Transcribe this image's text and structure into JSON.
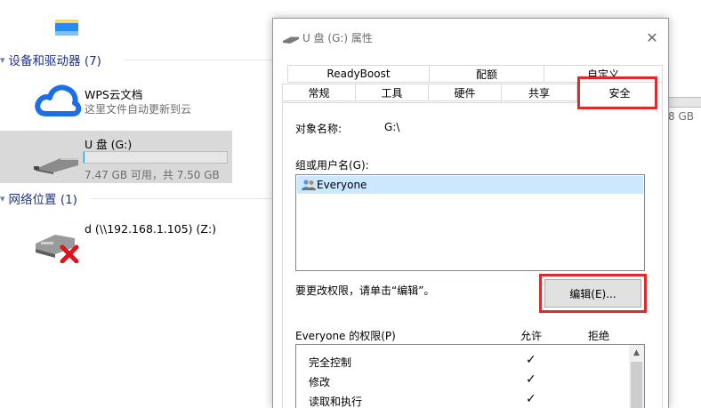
{
  "explorer": {
    "groups": [
      {
        "label": "设备和驱动器 (7)"
      },
      {
        "label": "网络位置 (1)"
      }
    ],
    "items": [
      {
        "title": "WPS云文档",
        "subtitle": "这里文件自动更新到云",
        "icon": "cloud-icon"
      },
      {
        "title": "U 盘 (G:)",
        "subtitle": "7.47 GB 可用，共 7.50 GB",
        "usage_fraction": 0.004,
        "icon": "usb-drive-icon"
      },
      {
        "title": "d (\\\\192.168.1.105) (Z:)",
        "icon": "disconnected-network-drive-icon"
      }
    ],
    "right_fragment": "8 GB"
  },
  "dialog": {
    "title": "U 盘 (G:) 属性",
    "close_glyph": "✕",
    "tabs_row1": [
      "ReadyBoost",
      "配额",
      "自定义"
    ],
    "tabs_row2": [
      "常规",
      "工具",
      "硬件",
      "共享",
      "安全"
    ],
    "active_tab": "安全",
    "object_name_label": "对象名称:",
    "object_name_value": "G:\\",
    "group_label": "组或用户名(G):",
    "users": [
      "Everyone"
    ],
    "change_hint": "要更改权限，请单击“编辑”。",
    "edit_button": "编辑(E)...",
    "perm_header": "Everyone 的权限(P)",
    "allow_label": "允许",
    "deny_label": "拒绝",
    "permissions": [
      {
        "name": "完全控制",
        "allow": "✓"
      },
      {
        "name": "修改",
        "allow": "✓"
      },
      {
        "name": "读取和执行",
        "allow": "✓"
      }
    ],
    "scroll_up_glyph": "▲"
  },
  "colors": {
    "highlight": "#e0292d",
    "group_header": "#1e3287",
    "selection": "#cce8ff",
    "progress": "#26a0da"
  }
}
